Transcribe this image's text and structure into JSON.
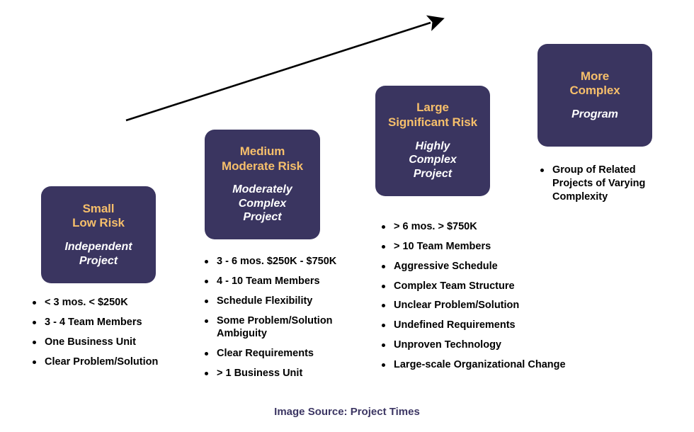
{
  "colors": {
    "box_fill": "#3a3560",
    "title_gold": "#f6bf6b",
    "subtitle_white": "#ffffff",
    "bullet_text": "#000000",
    "caption": "#3c3663",
    "arrow": "#000000",
    "background": "#ffffff"
  },
  "arrow": {
    "label": "complexity-growth-arrow",
    "direction": "up-right",
    "start": "178,170",
    "end": "621,28"
  },
  "stages": [
    {
      "id": "small",
      "title": "Small\nLow Risk",
      "subtitle": "Independent\nProject",
      "bullets": [
        "< 3 mos. < $250K",
        "3 - 4 Team Members",
        "One Business Unit",
        "Clear Problem/Solution"
      ]
    },
    {
      "id": "medium",
      "title": "Medium\nModerate Risk",
      "subtitle": "Moderately\nComplex\nProject",
      "bullets": [
        "3 - 6 mos. $250K - $750K",
        "4 - 10 Team Members",
        "Schedule Flexibility",
        "Some Problem/Solution Ambiguity",
        "Clear Requirements",
        "> 1 Business Unit"
      ]
    },
    {
      "id": "large",
      "title": "Large\nSignificant Risk",
      "subtitle": "Highly\nComplex\nProject",
      "bullets": [
        "> 6 mos. > $750K",
        "> 10 Team Members",
        "Aggressive Schedule",
        "Complex Team Structure",
        "Unclear Problem/Solution",
        "Undefined Requirements",
        "Unproven Technology",
        "Large-scale Organizational Change"
      ]
    },
    {
      "id": "program",
      "title": "More\nComplex",
      "subtitle": "Program",
      "bullets": [
        "Group of Related Projects of Varying Complexity"
      ]
    }
  ],
  "caption": "Image Source: Project Times"
}
